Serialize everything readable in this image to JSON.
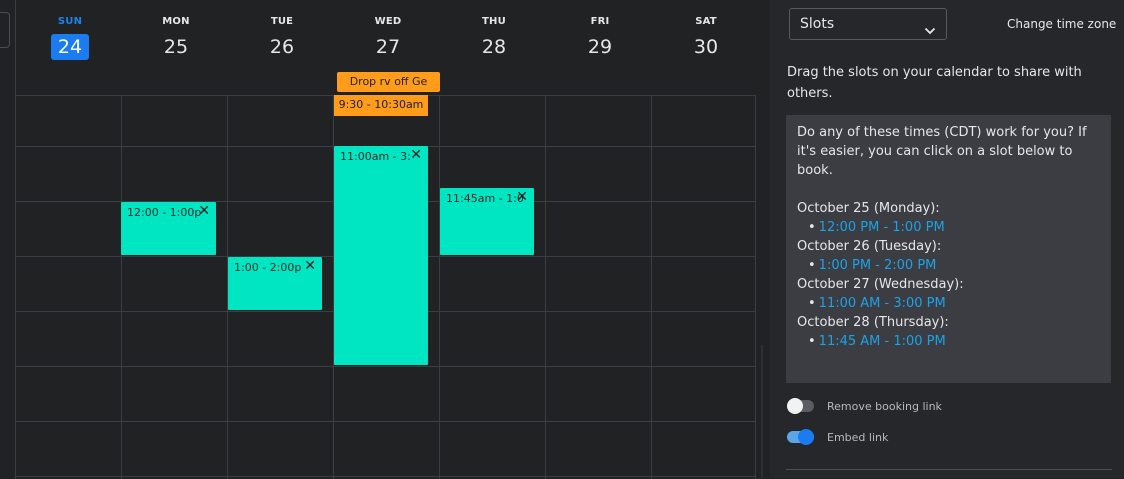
{
  "calendar": {
    "days": [
      {
        "dow": "SUN",
        "date": "24",
        "today": true
      },
      {
        "dow": "MON",
        "date": "25",
        "today": false
      },
      {
        "dow": "TUE",
        "date": "26",
        "today": false
      },
      {
        "dow": "WED",
        "date": "27",
        "today": false
      },
      {
        "dow": "THU",
        "date": "28",
        "today": false
      },
      {
        "dow": "FRI",
        "date": "29",
        "today": false
      },
      {
        "dow": "SAT",
        "date": "30",
        "today": false
      }
    ],
    "allday_event": "Drop rv off Ge",
    "orange_event": "9:30 - 10:30am",
    "slots": [
      {
        "label": "12:00 - 1:00p",
        "close": "✕"
      },
      {
        "label": "1:00 - 2:00p",
        "close": "✕"
      },
      {
        "label": "11:00am - 3:",
        "close": "✕"
      },
      {
        "label": "11:45am - 1:0",
        "close": "✕"
      }
    ],
    "colors": {
      "slot": "#00e6c3",
      "event": "#ff9c1a",
      "today": "#1a7cf0"
    }
  },
  "panel": {
    "select_value": "Slots",
    "change_tz": "Change time zone",
    "instructions": "Drag the slots on your calendar to share with others.",
    "share": {
      "intro": "Do any of these times (CDT) work for you? If it's easier, you can click on a slot below to book.",
      "groups": [
        {
          "date": "October 25 (Monday):",
          "slot": "12:00 PM - 1:00 PM"
        },
        {
          "date": "October 26 (Tuesday):",
          "slot": "1:00 PM - 2:00 PM"
        },
        {
          "date": "October 27 (Wednesday):",
          "slot": "11:00 AM - 3:00 PM"
        },
        {
          "date": "October 28 (Thursday):",
          "slot": "11:45 AM - 1:00 PM"
        }
      ],
      "bullet": "•"
    },
    "toggles": [
      {
        "label": "Remove booking link",
        "on": false
      },
      {
        "label": "Embed link",
        "on": true
      }
    ]
  }
}
